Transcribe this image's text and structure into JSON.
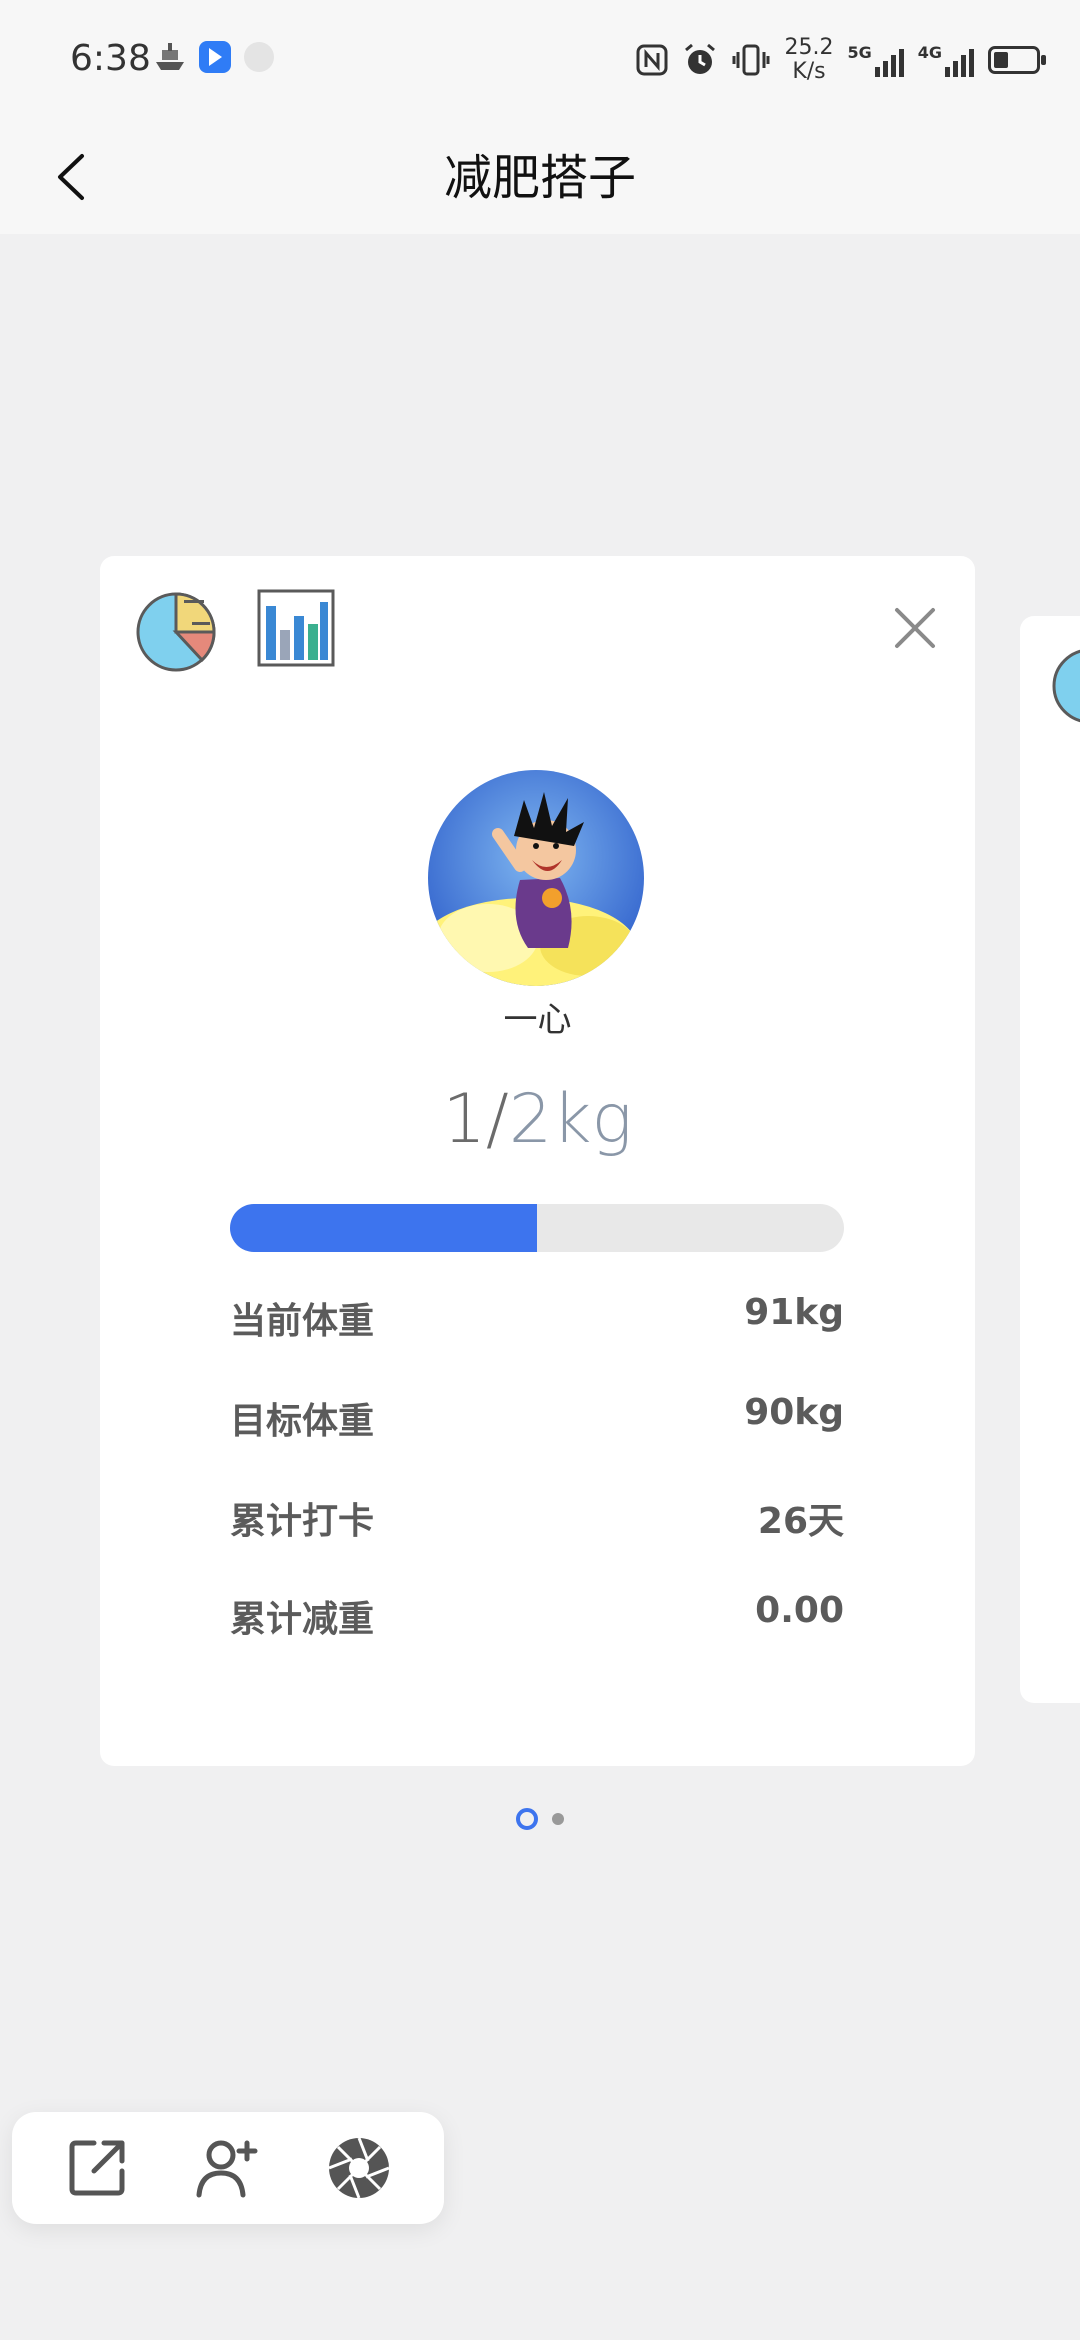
{
  "status_bar": {
    "time": "6:38",
    "net_speed_value": "25.2",
    "net_speed_unit": "K/s",
    "signal1_label": "5G",
    "signal2_label": "4G",
    "battery_level": 0.35
  },
  "nav": {
    "title": "减肥搭子",
    "back_icon": "chevron-left-icon"
  },
  "card": {
    "icons": [
      "pie-chart-icon",
      "bar-chart-icon",
      "close-icon"
    ],
    "username": "一心",
    "progress_current": "1/",
    "progress_target": "2kg",
    "progress_fraction": 0.5,
    "stats": [
      {
        "label": "当前体重",
        "value": "91kg"
      },
      {
        "label": "目标体重",
        "value": "90kg"
      },
      {
        "label": "累计打卡",
        "value": "26天"
      },
      {
        "label": "累计减重",
        "value": "0.00"
      }
    ]
  },
  "pager": {
    "count": 2,
    "active_index": 0
  },
  "toolbar": {
    "icons": [
      "share-icon",
      "add-user-icon",
      "camera-shutter-icon"
    ]
  },
  "colors": {
    "accent": "#3d74ee",
    "background": "#f0f0f1"
  }
}
